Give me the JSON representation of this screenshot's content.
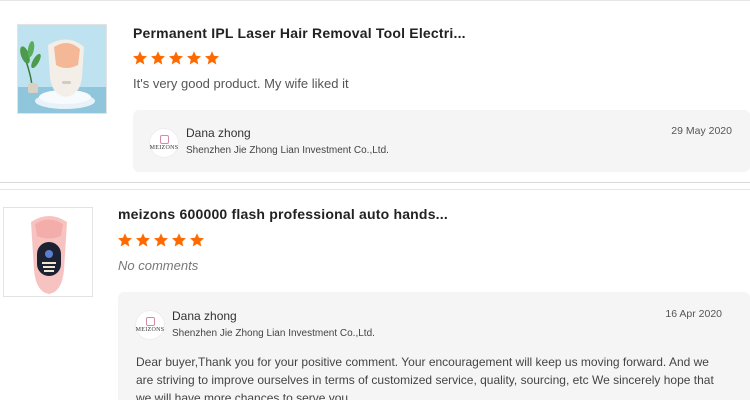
{
  "reviews": [
    {
      "product_title": "Permanent IPL Laser Hair Removal Tool Electri...",
      "rating": 5,
      "max_rating": 5,
      "comment": "It's very good product. My wife liked it",
      "reply": {
        "seller_name": "Dana zhong",
        "company": "Shenzhen Jie Zhong Lian Investment Co.,Ltd.",
        "date": "29 May 2020",
        "logo_text": "MEIZONS",
        "text": ""
      }
    },
    {
      "product_title": "meizons 600000 flash professional auto hands...",
      "rating": 5,
      "max_rating": 5,
      "comment": "No comments",
      "reply": {
        "seller_name": "Dana zhong",
        "company": "Shenzhen Jie Zhong Lian Investment Co.,Ltd.",
        "date": "16 Apr 2020",
        "logo_text": "MEIZONS",
        "text": "Dear buyer,Thank you for your positive comment. Your encouragement will keep us moving forward. And we are striving to improve ourselves in terms of customized service, quality, sourcing, etc We sincerely hope that we will have more chances to serve you."
      }
    }
  ],
  "colors": {
    "star": "#ff6a00",
    "reply_bg": "#f5f5f5"
  },
  "icons": {
    "star": "star-icon"
  }
}
